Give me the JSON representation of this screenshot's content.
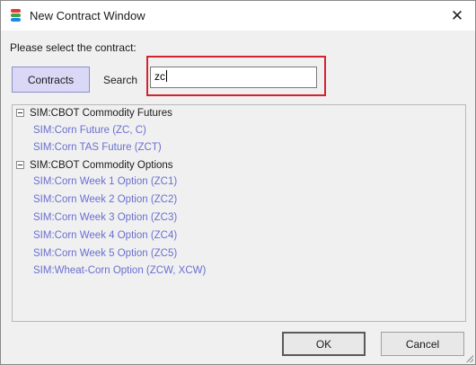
{
  "window": {
    "title": "New Contract Window",
    "close_glyph": "✕",
    "app_icon": "stacked-bars-icon",
    "icon_colors": [
      "#e53935",
      "#43a047",
      "#1e88e5"
    ]
  },
  "prompt": "Please select the contract:",
  "toolbar": {
    "contracts_label": "Contracts",
    "search_label": "Search",
    "search_value": "zc"
  },
  "highlight_color": "#d4232f",
  "tree": {
    "groups": [
      {
        "label": "SIM:CBOT Commodity Futures",
        "items": [
          "SIM:Corn Future (ZC, C)",
          "SIM:Corn TAS Future (ZCT)"
        ]
      },
      {
        "label": "SIM:CBOT Commodity Options",
        "items": [
          "SIM:Corn Week 1 Option (ZC1)",
          "SIM:Corn Week 2 Option (ZC2)",
          "SIM:Corn Week 3 Option (ZC3)",
          "SIM:Corn Week 4 Option (ZC4)",
          "SIM:Corn Week 5 Option (ZC5)",
          "SIM:Wheat-Corn Option (ZCW, XCW)"
        ]
      }
    ]
  },
  "buttons": {
    "ok": "OK",
    "cancel": "Cancel"
  }
}
